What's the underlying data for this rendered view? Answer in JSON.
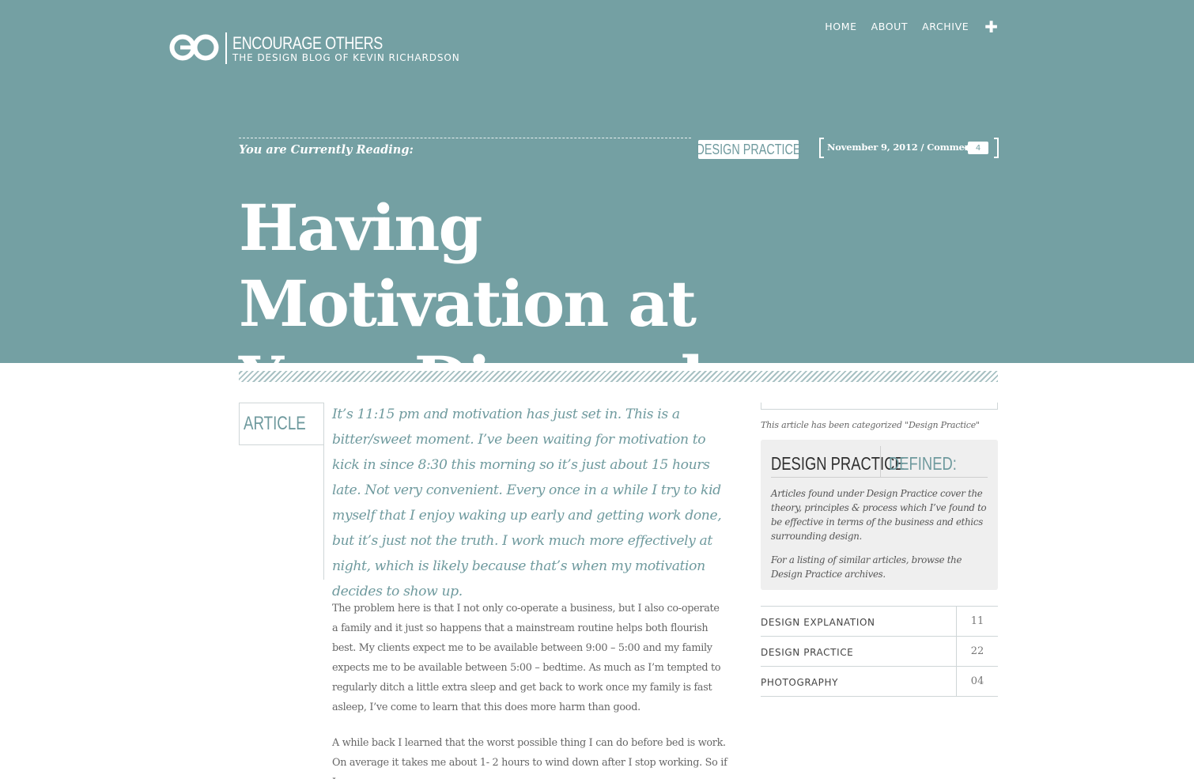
{
  "site": {
    "title": "ENCOURAGE OTHERS",
    "subtitle": "THE DESIGN BLOG OF KEVIN RICHARDSON",
    "logo_icon": "eo-monogram-icon"
  },
  "nav": {
    "items": [
      {
        "label": "HOME"
      },
      {
        "label": "ABOUT"
      },
      {
        "label": "ARCHIVE"
      }
    ],
    "plus_label": "✚"
  },
  "post": {
    "reading_label": "You are Currently Reading:",
    "category": "DESIGN PRACTICE",
    "meta": "November 9, 2012 / Comments",
    "comments": "4",
    "title": "Having Motivation at Your Disposal",
    "section_label": "ARTICLE",
    "lede": "It’s 11:15 pm and motivation has just set in. This is a bitter/sweet moment. I’ve been waiting for motivation to kick in since 8:30 this morning so it’s just about 15 hours late. Not very convenient. Every once in a while I try to kid myself that I enjoy waking up early and getting work done, but it’s just not the truth. I work much more effectively at night, which is likely because that’s when my motivation decides to show up.",
    "paragraphs": [
      "The problem here is that I not only co-operate a business, but I also co-operate a family and it just so happens that a mainstream routine helps both flourish best. My clients expect me to be available between 9:00 – 5:00 and my family expects me to be available between 5:00 – bedtime. As much as I’m tempted to regularly ditch a little extra sleep and get back to work once my family is fast asleep, I’ve come to learn that this does more harm than good.",
      "A while back I learned that the worst possible thing I can do before bed is work. On average it takes me about 1- 2 hours to wind down after I stop working. So if I"
    ]
  },
  "sidebar": {
    "note": "This article has been categorized \"Design Practice\"",
    "definition": {
      "heading": "DESIGN PRACTICE",
      "heading_accent": "DEFINED:",
      "p1": "Articles found under Design Practice cover the theory, principles & process which I’ve found to be effective in terms of the business and ethics surrounding design.",
      "p2": "For a listing of similar articles, browse the Design Practice archives."
    },
    "categories": [
      {
        "name": "DESIGN EXPLANATION",
        "count": "11"
      },
      {
        "name": "DESIGN PRACTICE",
        "count": "22"
      },
      {
        "name": "PHOTOGRAPHY",
        "count": "04"
      }
    ]
  },
  "colors": {
    "hero": "#74a0a3",
    "accent": "#6f9a9e",
    "text": "#666666"
  }
}
